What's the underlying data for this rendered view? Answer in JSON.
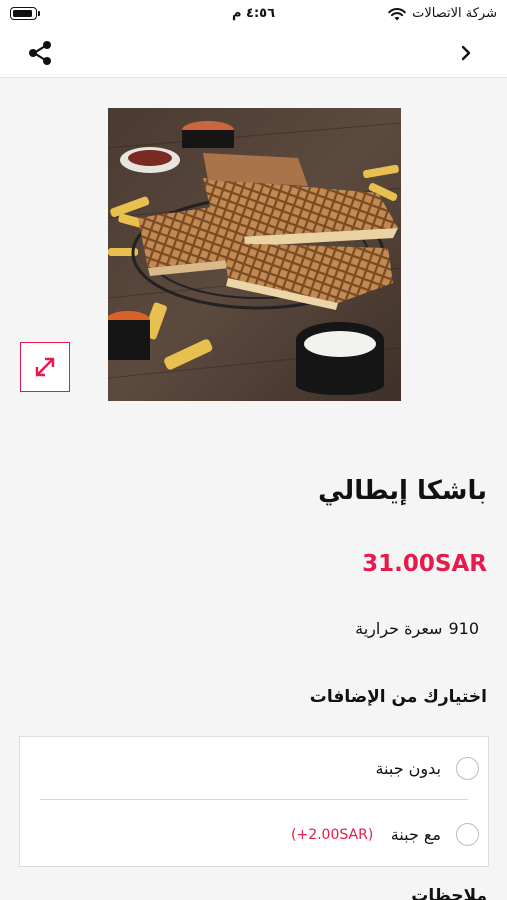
{
  "status_bar": {
    "time": "٤:٥٦ م",
    "carrier": "شركة الاتصالات"
  },
  "product": {
    "name": "باشكا إيطالي",
    "price": "31.00SAR",
    "calories_value": "910",
    "calories_label": "سعرة حرارية"
  },
  "addons": {
    "title": "اختيارك من الإضافات",
    "options": [
      {
        "label": "بدون جبنة",
        "extra": "",
        "selected": false
      },
      {
        "label": "مع جبنة",
        "extra": "(+2.00SAR)",
        "selected": false
      }
    ]
  },
  "notes": {
    "title": "ملاحظات"
  },
  "icons": {
    "share": "share-icon",
    "back": "chevron-right-icon",
    "expand": "expand-arrows-icon",
    "battery": "battery-icon",
    "wifi": "wifi-icon"
  },
  "colors": {
    "accent": "#e8194d",
    "text": "#111111",
    "background": "#f5f5f5"
  }
}
